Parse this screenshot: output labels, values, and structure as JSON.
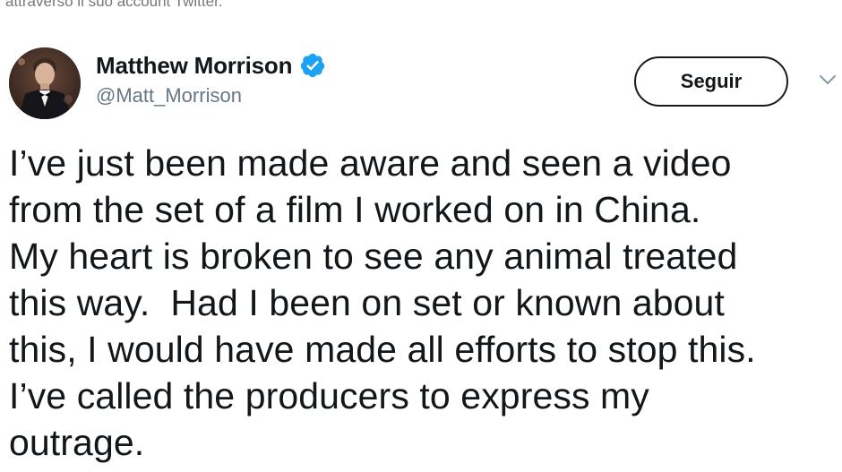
{
  "caption": {
    "text": "attraverso il suo account Twitter."
  },
  "tweet": {
    "author": {
      "display_name": "Matthew Morrison",
      "handle": "@Matt_Morrison",
      "verified": true
    },
    "follow_button_label": "Seguir",
    "text_lines": [
      "I’ve just been made aware and seen a video",
      "from the set of a film I worked on in China.",
      "My heart is broken to see any animal treated",
      "this way.  Had I been on set or known about",
      "this, I would have made all efforts to stop this.",
      "I’ve called the producers to express my",
      "outrage."
    ]
  },
  "icons": {
    "verified": "verified-badge-icon",
    "menu": "chevron-down-icon",
    "avatar": "profile-photo"
  },
  "colors": {
    "verified_blue": "#1da1f2",
    "handle_gray": "#657786",
    "text": "#14171a",
    "chevron": "#8899a6"
  }
}
